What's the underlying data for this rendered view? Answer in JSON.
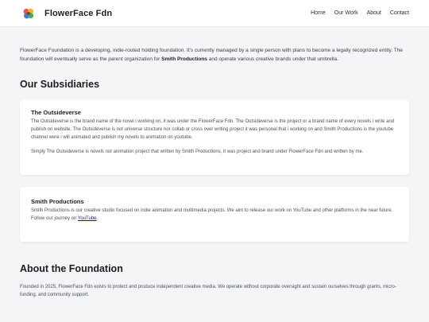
{
  "header": {
    "brand": "FlowerFace Fdn",
    "nav": [
      "Home",
      "Our Work",
      "About",
      "Contact"
    ]
  },
  "intro": {
    "text_1": "FlowerFace Foundation is a developing, indie-rooted holding foundation. It's currently managed by a single person with plans to become a legally recognized entity. The foundation will eventually serve as the parent organization for ",
    "bold": "Smith Productions",
    "text_2": " and operate various creative brands under that umbrella."
  },
  "subsidiaries": {
    "title": "Our Subsidiaries",
    "items": [
      {
        "name": "The Outsideverse",
        "p1": "The Outsideverse is the brand name of the novel i working on, it was under the FlowerFace Fdn. The Outsideverse is the project or a brand name of every novels i write and publish on website, The Outsideverse is not universe structure nor collab or cross over writing project it was personal that i working on and Smith Productions is the youtube channel were i will animated and publish my novels to animation on youtube.",
        "p2": "Simply The Outsideverse is novels not animation project that written by Smith Productions, it was project and brand under FlowerFace Fdn and written by me."
      },
      {
        "name": "Smith Productions",
        "p1_before": "Smith Productions is our creative studio focused on indie animation and multimedia projects. We aim to release our work on YouTube and other platforms in the near future. Follow our journey on ",
        "link": "YouTube",
        "p1_after": "."
      }
    ]
  },
  "about": {
    "title": "About the Foundation",
    "text": "Founded in 2025, FlowerFace Fdn exists to protect and produce independent creative media. We operate without corporate oversight and sustain ourselves through grants, micro-funding, and community support."
  },
  "colors": {
    "background": "#f4f5f7",
    "link": "#1a0dab",
    "logo_petals": [
      "#e8563f",
      "#f2b233",
      "#3f7fd6",
      "#4aa867"
    ]
  },
  "icons": {
    "logo": "flower-logo-icon"
  }
}
